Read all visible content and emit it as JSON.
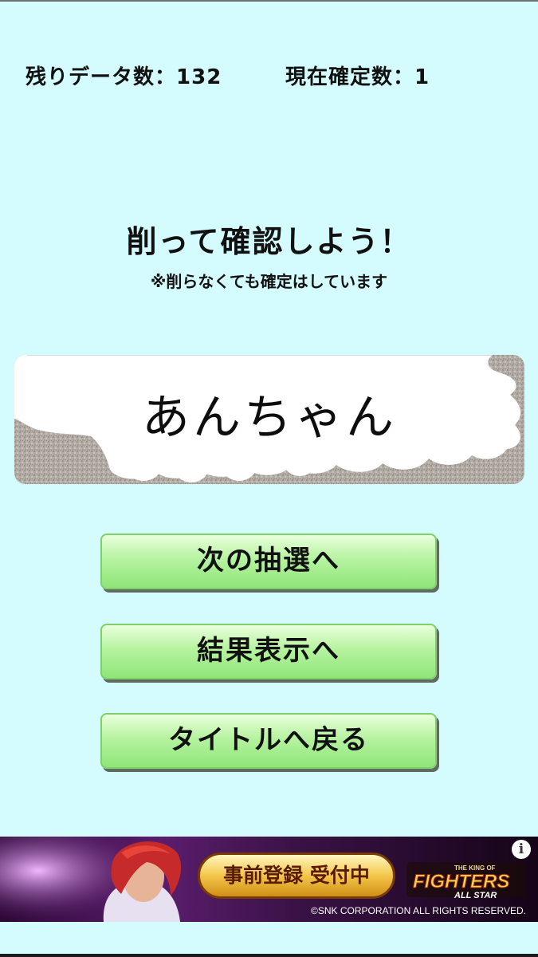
{
  "stats": {
    "remaining_label": "残りデータ数：",
    "remaining_value": "132",
    "confirmed_label": "現在確定数：",
    "confirmed_value": "1"
  },
  "scratch": {
    "heading": "削って確認しよう！",
    "note": "※削らなくても確定はしています",
    "result": "あんちゃん"
  },
  "buttons": {
    "next": "次の抽選へ",
    "result": "結果表示へ",
    "title": "タイトルへ戻る"
  },
  "ad": {
    "cta": "事前登録 受付中",
    "logo_top": "THE KING OF",
    "logo_main": "FIGHTERS",
    "logo_sub": "ALL STAR",
    "copyright": "©SNK CORPORATION ALL RIGHTS RESERVED.",
    "info": "i"
  }
}
